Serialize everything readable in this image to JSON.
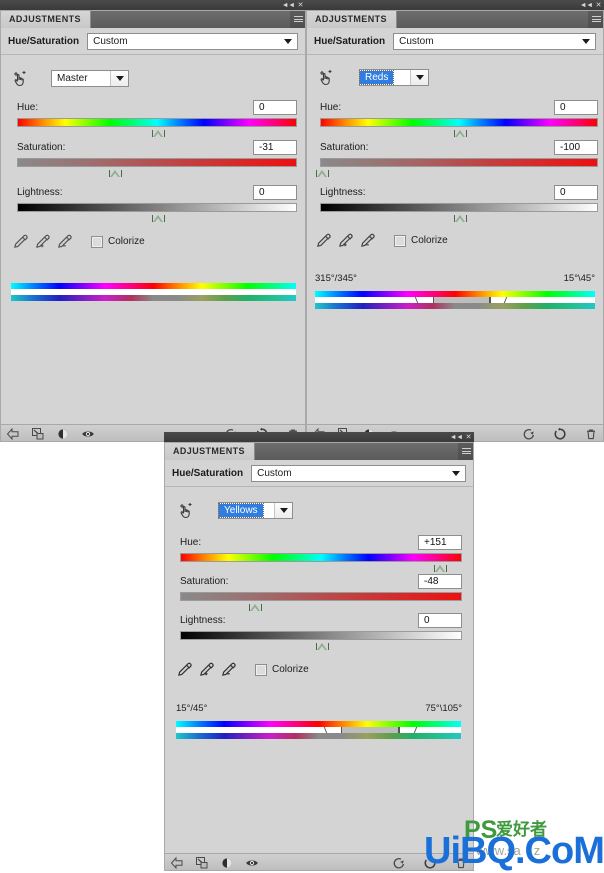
{
  "window": {
    "collapse_icon": "collapse-double-arrow-icon",
    "close_icon": "close-icon",
    "collapse_glyph": "◄◄",
    "close_glyph": "✕"
  },
  "panels": [
    {
      "id": "panel-master",
      "tab_label": "ADJUSTMENTS",
      "panel_menu_icon": "panel-menu-icon",
      "title": "Hue/Saturation",
      "preset": {
        "label": "Hue/Saturation",
        "value": "Custom",
        "placeholder": "Custom"
      },
      "channel": {
        "value": "Master",
        "selected": false
      },
      "target_adjust_icon": "target-adjustment-hand-icon",
      "sliders": [
        {
          "name": "Hue",
          "label": "Hue:",
          "value": "0",
          "percent": 50.0,
          "track": "hue"
        },
        {
          "name": "Saturation",
          "label": "Saturation:",
          "value": "-31",
          "percent": 34.5,
          "track": "sat"
        },
        {
          "name": "Lightness",
          "label": "Lightness:",
          "value": "0",
          "percent": 50.0,
          "track": "light"
        }
      ],
      "eyedroppers": [
        {
          "icon": "eyedropper-icon",
          "name": "sample-color"
        },
        {
          "icon": "eyedropper-plus-icon",
          "name": "add-to-sample"
        },
        {
          "icon": "eyedropper-minus-icon",
          "name": "subtract-from-sample"
        }
      ],
      "colorize": {
        "label": "Colorize",
        "checked": false
      },
      "range_labels": {
        "left": "",
        "right": ""
      },
      "range_handles_visible": false,
      "footer": {
        "left": [
          {
            "icon": "return-to-adjustment-list-icon",
            "name": "back-button"
          },
          {
            "icon": "clip-to-layer-icon",
            "name": "clip-to-layer-button"
          },
          {
            "icon": "toggle-layer-visibility-icon",
            "name": "preview-toggle-button"
          },
          {
            "icon": "eye-icon",
            "name": "view-previous-state-button"
          }
        ],
        "right": [
          {
            "icon": "reset-to-previous-icon",
            "name": "reset-previous-button"
          },
          {
            "icon": "reset-icon",
            "name": "reset-adjustment-button"
          },
          {
            "icon": "trash-icon",
            "name": "delete-adjustment-button"
          }
        ]
      }
    },
    {
      "id": "panel-reds",
      "tab_label": "ADJUSTMENTS",
      "panel_menu_icon": "panel-menu-icon",
      "title": "Hue/Saturation",
      "preset": {
        "label": "Hue/Saturation",
        "value": "Custom",
        "placeholder": "Custom"
      },
      "channel": {
        "value": "Reds",
        "selected": true
      },
      "target_adjust_icon": "target-adjustment-hand-icon",
      "sliders": [
        {
          "name": "Hue",
          "label": "Hue:",
          "value": "0",
          "percent": 50.0,
          "track": "hue"
        },
        {
          "name": "Saturation",
          "label": "Saturation:",
          "value": "-100",
          "percent": 0.0,
          "track": "sat"
        },
        {
          "name": "Lightness",
          "label": "Lightness:",
          "value": "0",
          "percent": 50.0,
          "track": "light"
        }
      ],
      "eyedroppers": [
        {
          "icon": "eyedropper-icon",
          "name": "sample-color"
        },
        {
          "icon": "eyedropper-plus-icon",
          "name": "add-to-sample"
        },
        {
          "icon": "eyedropper-minus-icon",
          "name": "subtract-from-sample"
        }
      ],
      "colorize": {
        "label": "Colorize",
        "checked": false
      },
      "range_labels": {
        "left": "315°/345°",
        "right": "15°\\45°"
      },
      "range_handles_visible": true,
      "range": {
        "fall_start_pct": 34.0,
        "start_pct": 42.0,
        "end_pct": 62.0,
        "fall_end_pct": 70.0
      },
      "footer": {
        "left": [
          {
            "icon": "return-to-adjustment-list-icon",
            "name": "back-button"
          },
          {
            "icon": "clip-to-layer-icon",
            "name": "clip-to-layer-button"
          },
          {
            "icon": "toggle-layer-visibility-icon",
            "name": "preview-toggle-button"
          },
          {
            "icon": "eye-icon",
            "name": "view-previous-state-button"
          }
        ],
        "right": [
          {
            "icon": "reset-to-previous-icon",
            "name": "reset-previous-button"
          },
          {
            "icon": "reset-icon",
            "name": "reset-adjustment-button"
          },
          {
            "icon": "trash-icon",
            "name": "delete-adjustment-button"
          }
        ]
      }
    },
    {
      "id": "panel-yellows",
      "tab_label": "ADJUSTMENTS",
      "panel_menu_icon": "panel-menu-icon",
      "title": "Hue/Saturation",
      "preset": {
        "label": "Hue/Saturation",
        "value": "Custom",
        "placeholder": "Custom"
      },
      "channel": {
        "value": "Yellows",
        "selected": true
      },
      "target_adjust_icon": "target-adjustment-hand-icon",
      "sliders": [
        {
          "name": "Hue",
          "label": "Hue:",
          "value": "+151",
          "percent": 92.0,
          "track": "hue"
        },
        {
          "name": "Saturation",
          "label": "Saturation:",
          "value": "-48",
          "percent": 26.0,
          "track": "sat"
        },
        {
          "name": "Lightness",
          "label": "Lightness:",
          "value": "0",
          "percent": 50.0,
          "track": "light"
        }
      ],
      "eyedroppers": [
        {
          "icon": "eyedropper-icon",
          "name": "sample-color"
        },
        {
          "icon": "eyedropper-plus-icon",
          "name": "add-to-sample"
        },
        {
          "icon": "eyedropper-minus-icon",
          "name": "subtract-from-sample"
        }
      ],
      "colorize": {
        "label": "Colorize",
        "checked": false
      },
      "range_labels": {
        "left": "15°/45°",
        "right": "75°\\105°"
      },
      "range_handles_visible": true,
      "range": {
        "fall_start_pct": 50.0,
        "start_pct": 58.0,
        "end_pct": 78.0,
        "fall_end_pct": 86.0
      },
      "footer": {
        "left": [
          {
            "icon": "return-to-adjustment-list-icon",
            "name": "back-button"
          },
          {
            "icon": "clip-to-layer-icon",
            "name": "clip-to-layer-button"
          },
          {
            "icon": "toggle-layer-visibility-icon",
            "name": "preview-toggle-button"
          },
          {
            "icon": "eye-icon",
            "name": "view-previous-state-button"
          }
        ],
        "right": [
          {
            "icon": "reset-to-previous-icon",
            "name": "reset-previous-button"
          },
          {
            "icon": "reset-icon",
            "name": "reset-adjustment-button"
          },
          {
            "icon": "trash-icon",
            "name": "delete-adjustment-button"
          }
        ]
      }
    }
  ],
  "watermark": {
    "main": "UiBQ.CoM",
    "brand": "PS",
    "chinese": "爱好者",
    "site": "www.sa　z",
    "main_color": "#1a6fd8",
    "brand_color": "#3f9a3f"
  }
}
